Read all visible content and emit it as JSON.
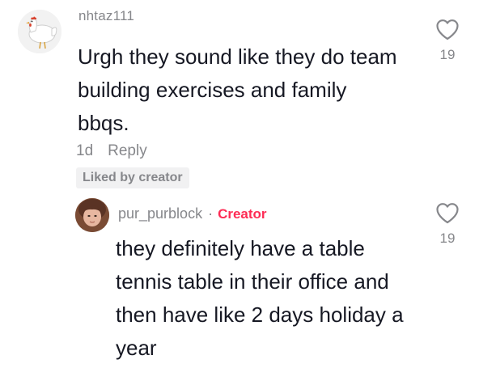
{
  "comment": {
    "username": "nhtaz111",
    "text": "Urgh they sound like they do team building exercises and family bbqs.",
    "age": "1d",
    "reply_label": "Reply",
    "liked_badge": "Liked by creator",
    "like_count": "19",
    "avatar_icon": "white-hen-icon"
  },
  "reply": {
    "username": "pur_purblock",
    "separator": "·",
    "creator_label": "Creator",
    "text": "they definitely have a table tennis table in their office and then have like 2 days holiday a year",
    "like_count": "19",
    "avatar_icon": "profile-photo"
  },
  "colors": {
    "text_primary": "#161823",
    "text_secondary": "#86878b",
    "creator_accent": "#fe2c55",
    "badge_bg": "#f1f1f2"
  }
}
